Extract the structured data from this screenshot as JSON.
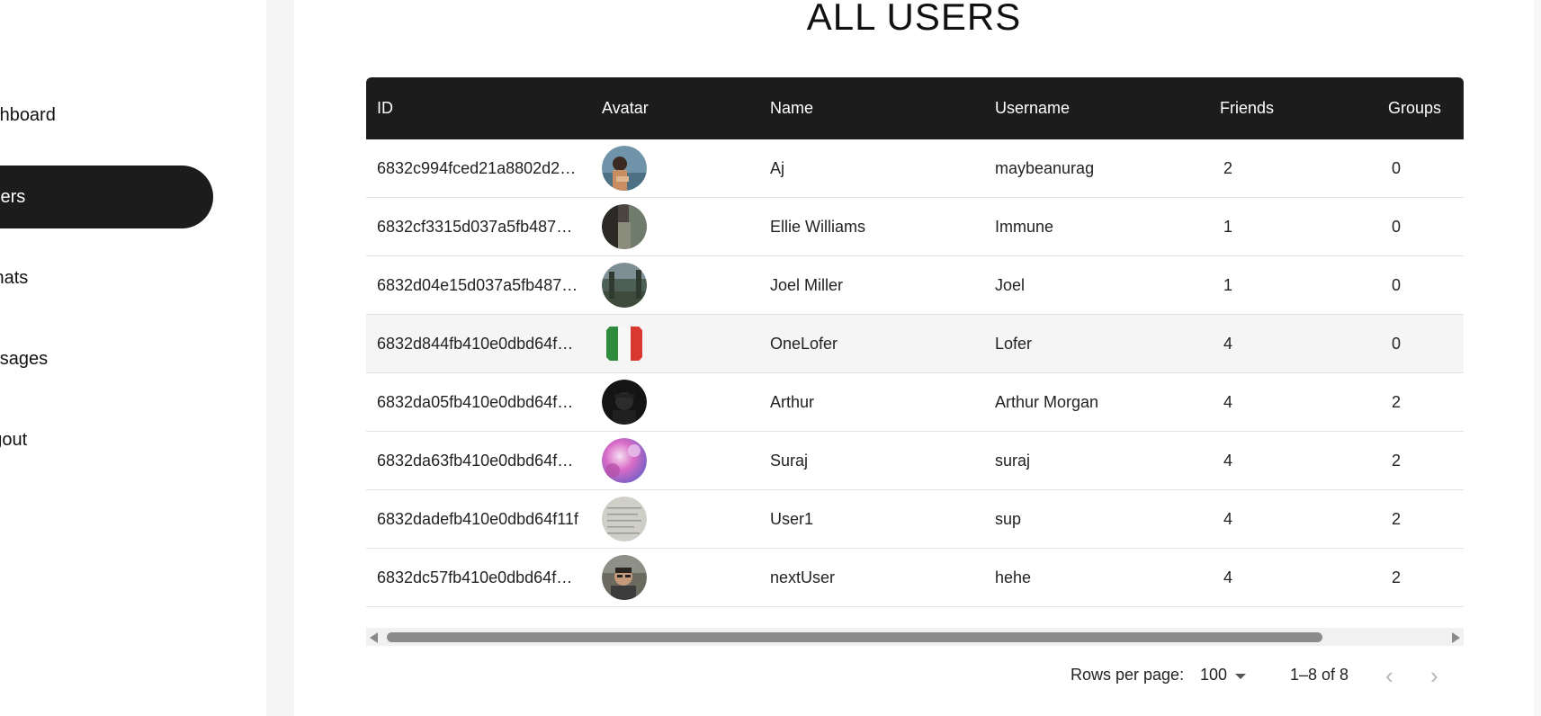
{
  "sidebar": {
    "items": [
      {
        "label": "Dashboard",
        "active": false
      },
      {
        "label": "Users",
        "active": true
      },
      {
        "label": "Chats",
        "active": false
      },
      {
        "label": "Messages",
        "active": false
      },
      {
        "label": "Logout",
        "active": false
      }
    ]
  },
  "page": {
    "title": "ALL USERS"
  },
  "table": {
    "columns": [
      "ID",
      "Avatar",
      "Name",
      "Username",
      "Friends",
      "Groups"
    ],
    "rows": [
      {
        "id": "6832c994fced21a8802d2…",
        "name": "Aj",
        "username": "maybeanurag",
        "friends": "2",
        "groups": "0",
        "avatar": "photo-person-outdoor"
      },
      {
        "id": "6832cf3315d037a5fb487…",
        "name": "Ellie Williams",
        "username": "Immune",
        "friends": "1",
        "groups": "0",
        "avatar": "photo-forest"
      },
      {
        "id": "6832d04e15d037a5fb487…",
        "name": "Joel Miller",
        "username": "Joel",
        "friends": "1",
        "groups": "0",
        "avatar": "photo-landscape"
      },
      {
        "id": "6832d844fb410e0dbd64f…",
        "name": "OneLofer",
        "username": "Lofer",
        "friends": "4",
        "groups": "0",
        "avatar": "flag-italy",
        "highlighted": true
      },
      {
        "id": "6832da05fb410e0dbd64f…",
        "name": "Arthur",
        "username": "Arthur Morgan",
        "friends": "4",
        "groups": "2",
        "avatar": "photo-dark-portrait"
      },
      {
        "id": "6832da63fb410e0dbd64f10f",
        "name": "Suraj",
        "username": "suraj",
        "friends": "4",
        "groups": "2",
        "avatar": "abstract-colorful"
      },
      {
        "id": "6832dadefb410e0dbd64f11f",
        "name": "User1",
        "username": "sup",
        "friends": "4",
        "groups": "2",
        "avatar": "photo-paper-note"
      },
      {
        "id": "6832dc57fb410e0dbd64f…",
        "name": "nextUser",
        "username": "hehe",
        "friends": "4",
        "groups": "2",
        "avatar": "photo-person-glasses"
      }
    ]
  },
  "pagination": {
    "rows_per_page_label": "Rows per page:",
    "rows_per_page_value": "100",
    "range_label": "1–8 of 8",
    "prev_icon": "chevron-left-icon",
    "next_icon": "chevron-right-icon"
  },
  "scrollbar": {
    "left_icon": "scroll-left-arrow",
    "right_icon": "scroll-right-arrow"
  },
  "colors": {
    "header_bg": "#1c1c1c",
    "active_nav_bg": "#1c1c1c",
    "row_highlight": "#f5f5f5"
  }
}
